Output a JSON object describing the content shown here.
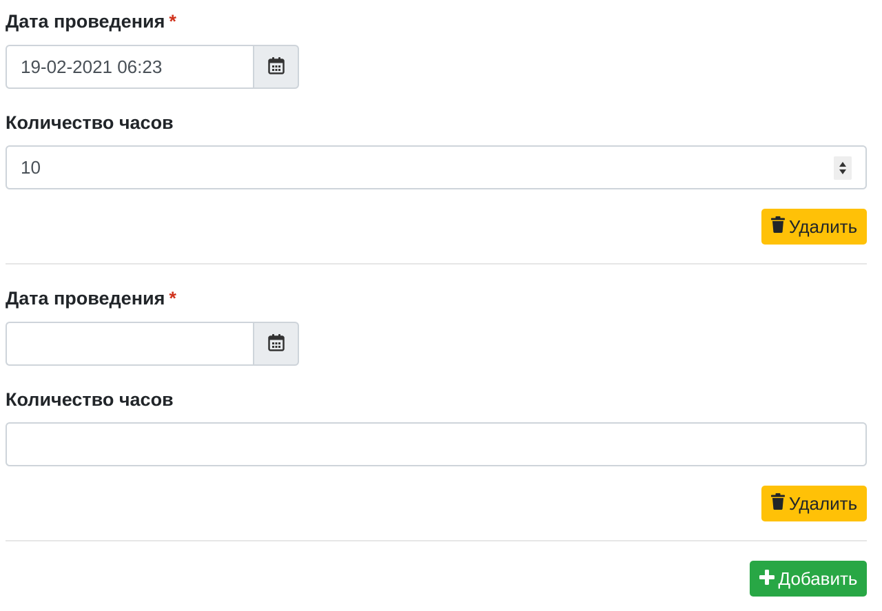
{
  "entries": [
    {
      "date_label": "Дата проведения",
      "required_mark": "*",
      "date_value": "19-02-2021 06:23",
      "hours_label": "Количество часов",
      "hours_value": "10",
      "delete_label": "Удалить"
    },
    {
      "date_label": "Дата проведения",
      "required_mark": "*",
      "date_value": "",
      "hours_label": "Количество часов",
      "hours_value": "",
      "delete_label": "Удалить"
    }
  ],
  "add_label": "Добавить",
  "colors": {
    "warning": "#ffc107",
    "success": "#28a745",
    "required": "#d0321c"
  },
  "icons": {
    "calendar": "calendar-icon",
    "delete": "trash-icon",
    "add": "plus-icon"
  }
}
